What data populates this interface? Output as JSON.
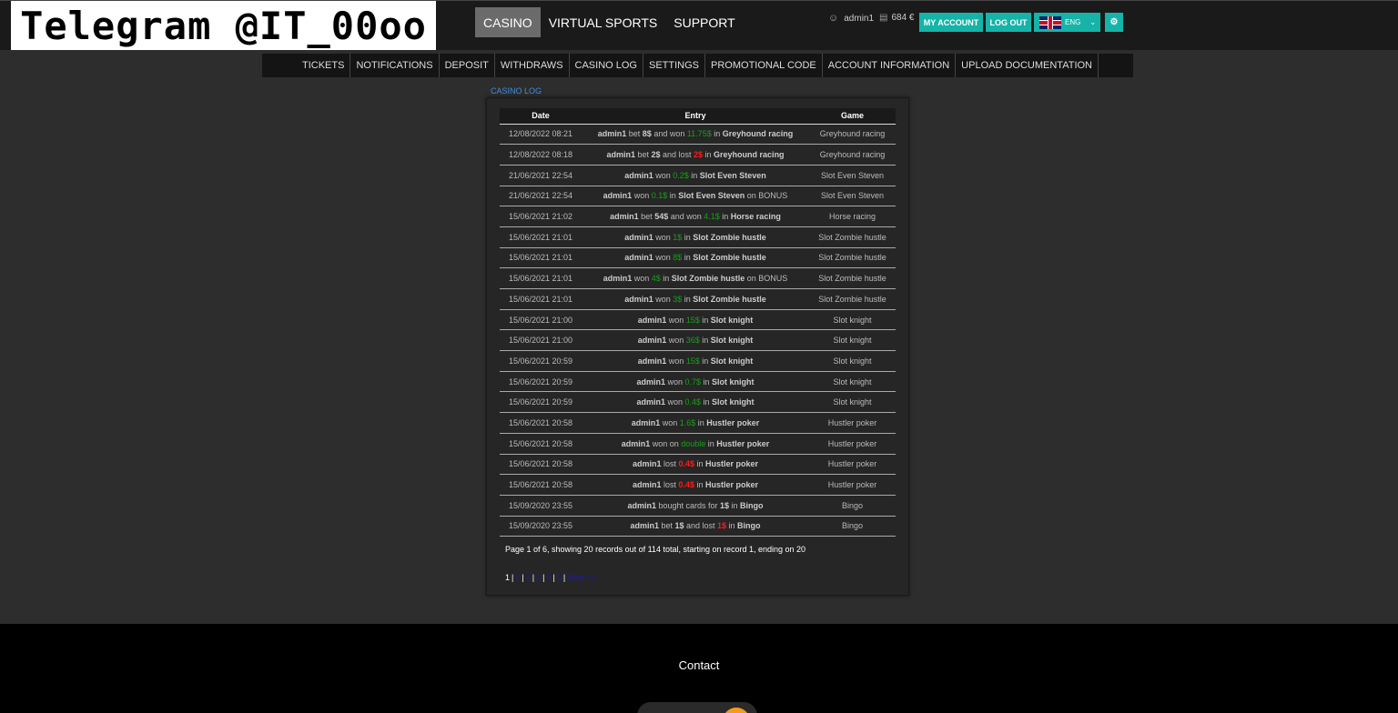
{
  "header": {
    "logo_text": "Telegram @IT_00oo",
    "nav": [
      "CASINO",
      "VIRTUAL SPORTS",
      "SUPPORT"
    ],
    "active_nav": "CASINO",
    "username": "admin1",
    "balance": "684 €",
    "my_account": "MY ACCOUNT",
    "logout": "LOG OUT",
    "language": "ENG",
    "user_icon": "user-icon",
    "wallet_icon": "wallet-icon",
    "gear_icon": "gear-icon"
  },
  "subnav": [
    "TICKETS",
    "NOTIFICATIONS",
    "DEPOSIT",
    "WITHDRAWS",
    "CASINO LOG",
    "SETTINGS",
    "PROMOTIONAL CODE",
    "ACCOUNT INFORMATION",
    "UPLOAD DOCUMENTATION"
  ],
  "breadcrumb": "CASINO LOG",
  "table": {
    "columns": [
      "Date",
      "Entry",
      "Game"
    ],
    "rows": [
      {
        "date": "12/08/2022 08:21",
        "user": "admin1",
        "parts": [
          [
            "t",
            " bet "
          ],
          [
            "b",
            "8$"
          ],
          [
            "t",
            " and won "
          ],
          [
            "g",
            "11.75$"
          ],
          [
            "t",
            " in "
          ],
          [
            "b",
            "Greyhound racing"
          ]
        ],
        "game": "Greyhound racing"
      },
      {
        "date": "12/08/2022 08:18",
        "user": "admin1",
        "parts": [
          [
            "t",
            " bet "
          ],
          [
            "b",
            "2$"
          ],
          [
            "t",
            " and lost "
          ],
          [
            "r",
            "2$"
          ],
          [
            "t",
            " in "
          ],
          [
            "b",
            "Greyhound racing"
          ]
        ],
        "game": "Greyhound racing"
      },
      {
        "date": "21/06/2021 22:54",
        "user": "admin1",
        "parts": [
          [
            "t",
            " won "
          ],
          [
            "g",
            "0.2$"
          ],
          [
            "t",
            " in "
          ],
          [
            "b",
            "Slot Even Steven"
          ]
        ],
        "game": "Slot Even Steven"
      },
      {
        "date": "21/06/2021 22:54",
        "user": "admin1",
        "parts": [
          [
            "t",
            " won "
          ],
          [
            "g",
            "0.1$"
          ],
          [
            "t",
            " in "
          ],
          [
            "b",
            "Slot Even Steven"
          ],
          [
            "t",
            " on BONUS"
          ]
        ],
        "game": "Slot Even Steven"
      },
      {
        "date": "15/06/2021 21:02",
        "user": "admin1",
        "parts": [
          [
            "t",
            " bet "
          ],
          [
            "b",
            "54$"
          ],
          [
            "t",
            " and won "
          ],
          [
            "g",
            "4.1$"
          ],
          [
            "t",
            " in "
          ],
          [
            "b",
            "Horse racing"
          ]
        ],
        "game": "Horse racing"
      },
      {
        "date": "15/06/2021 21:01",
        "user": "admin1",
        "parts": [
          [
            "t",
            " won "
          ],
          [
            "g",
            "1$"
          ],
          [
            "t",
            " in "
          ],
          [
            "b",
            "Slot Zombie hustle"
          ]
        ],
        "game": "Slot Zombie hustle"
      },
      {
        "date": "15/06/2021 21:01",
        "user": "admin1",
        "parts": [
          [
            "t",
            " won "
          ],
          [
            "g",
            "8$"
          ],
          [
            "t",
            " in "
          ],
          [
            "b",
            "Slot Zombie hustle"
          ]
        ],
        "game": "Slot Zombie hustle"
      },
      {
        "date": "15/06/2021 21:01",
        "user": "admin1",
        "parts": [
          [
            "t",
            " won "
          ],
          [
            "g",
            "4$"
          ],
          [
            "t",
            " in "
          ],
          [
            "b",
            "Slot Zombie hustle"
          ],
          [
            "t",
            " on BONUS"
          ]
        ],
        "game": "Slot Zombie hustle"
      },
      {
        "date": "15/06/2021 21:01",
        "user": "admin1",
        "parts": [
          [
            "t",
            " won "
          ],
          [
            "g",
            "3$"
          ],
          [
            "t",
            " in "
          ],
          [
            "b",
            "Slot Zombie hustle"
          ]
        ],
        "game": "Slot Zombie hustle"
      },
      {
        "date": "15/06/2021 21:00",
        "user": "admin1",
        "parts": [
          [
            "t",
            " won "
          ],
          [
            "g",
            "15$"
          ],
          [
            "t",
            " in "
          ],
          [
            "b",
            "Slot knight"
          ]
        ],
        "game": "Slot knight"
      },
      {
        "date": "15/06/2021 21:00",
        "user": "admin1",
        "parts": [
          [
            "t",
            " won "
          ],
          [
            "g",
            "36$"
          ],
          [
            "t",
            " in "
          ],
          [
            "b",
            "Slot knight"
          ]
        ],
        "game": "Slot knight"
      },
      {
        "date": "15/06/2021 20:59",
        "user": "admin1",
        "parts": [
          [
            "t",
            " won "
          ],
          [
            "g",
            "15$"
          ],
          [
            "t",
            " in "
          ],
          [
            "b",
            "Slot knight"
          ]
        ],
        "game": "Slot knight"
      },
      {
        "date": "15/06/2021 20:59",
        "user": "admin1",
        "parts": [
          [
            "t",
            " won "
          ],
          [
            "g",
            "0.7$"
          ],
          [
            "t",
            " in "
          ],
          [
            "b",
            "Slot knight"
          ]
        ],
        "game": "Slot knight"
      },
      {
        "date": "15/06/2021 20:59",
        "user": "admin1",
        "parts": [
          [
            "t",
            " won "
          ],
          [
            "g",
            "0.4$"
          ],
          [
            "t",
            " in "
          ],
          [
            "b",
            "Slot knight"
          ]
        ],
        "game": "Slot knight"
      },
      {
        "date": "15/06/2021 20:58",
        "user": "admin1",
        "parts": [
          [
            "t",
            " won "
          ],
          [
            "g",
            "1.6$"
          ],
          [
            "t",
            " in "
          ],
          [
            "b",
            "Hustler poker"
          ]
        ],
        "game": "Hustler poker"
      },
      {
        "date": "15/06/2021 20:58",
        "user": "admin1",
        "parts": [
          [
            "t",
            " won on "
          ],
          [
            "g",
            "double"
          ],
          [
            "t",
            " in "
          ],
          [
            "b",
            "Hustler poker"
          ]
        ],
        "game": "Hustler poker"
      },
      {
        "date": "15/06/2021 20:58",
        "user": "admin1",
        "parts": [
          [
            "t",
            " lost "
          ],
          [
            "r",
            "0.4$"
          ],
          [
            "t",
            " in "
          ],
          [
            "b",
            "Hustler poker"
          ]
        ],
        "game": "Hustler poker"
      },
      {
        "date": "15/06/2021 20:58",
        "user": "admin1",
        "parts": [
          [
            "t",
            " lost "
          ],
          [
            "r",
            "0.4$"
          ],
          [
            "t",
            " in "
          ],
          [
            "b",
            "Hustler poker"
          ]
        ],
        "game": "Hustler poker"
      },
      {
        "date": "15/09/2020 23:55",
        "user": "admin1",
        "parts": [
          [
            "t",
            " bought cards for "
          ],
          [
            "b",
            "1$"
          ],
          [
            "t",
            " in "
          ],
          [
            "b",
            "Bingo"
          ]
        ],
        "game": "Bingo"
      },
      {
        "date": "15/09/2020 23:55",
        "user": "admin1",
        "parts": [
          [
            "t",
            " bet "
          ],
          [
            "b",
            "1$"
          ],
          [
            "t",
            " and lost "
          ],
          [
            "r",
            "1$"
          ],
          [
            "t",
            " in "
          ],
          [
            "b",
            "Bingo"
          ]
        ],
        "game": "Bingo"
      }
    ]
  },
  "page_info": "Page 1 of 6, showing 20 records out of 114 total, starting on record 1, ending on 20",
  "pager": {
    "current": "1",
    "pages": [
      "2",
      "3",
      "4",
      "5",
      "6"
    ],
    "next": "Next >>"
  },
  "footer": {
    "contact": "Contact"
  },
  "colors": {
    "accent": "#16b4a8",
    "win": "#16a016",
    "loss": "#ff1a1a",
    "link": "#3d8ee0"
  }
}
